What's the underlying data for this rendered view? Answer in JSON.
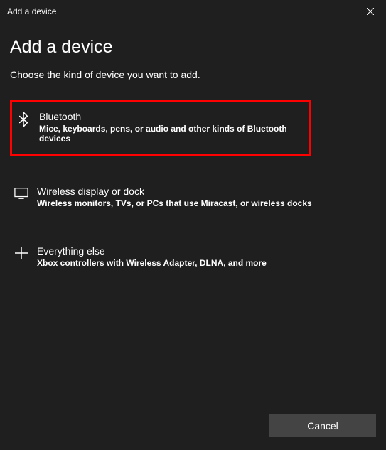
{
  "titlebar": {
    "title": "Add a device"
  },
  "heading": "Add a device",
  "subheading": "Choose the kind of device you want to add.",
  "options": [
    {
      "title": "Bluetooth",
      "desc": "Mice, keyboards, pens, or audio and other kinds of Bluetooth devices"
    },
    {
      "title": "Wireless display or dock",
      "desc": "Wireless monitors, TVs, or PCs that use Miracast, or wireless docks"
    },
    {
      "title": "Everything else",
      "desc": "Xbox controllers with Wireless Adapter, DLNA, and more"
    }
  ],
  "footer": {
    "cancel": "Cancel"
  }
}
